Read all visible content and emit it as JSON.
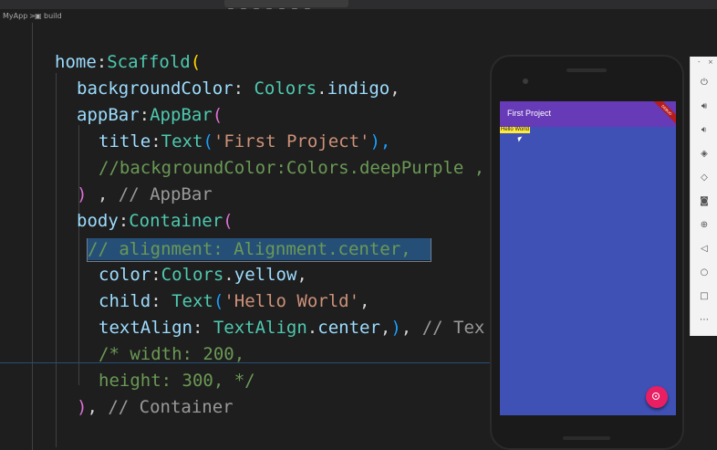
{
  "breadcrumb": {
    "items": [
      "MyApp",
      ">",
      "build"
    ]
  },
  "editor": {
    "lines": [
      [
        "home",
        ":",
        "Scaffold",
        "("
      ],
      [
        "backgroundColor",
        ": ",
        "Colors",
        ".",
        "indigo",
        ","
      ],
      [
        "appBar",
        ":",
        "AppBar",
        "("
      ],
      [
        "title",
        ":",
        "Text",
        "(",
        "'First Project'",
        "),"
      ],
      [
        "//backgroundColor:Colors.deepPurple ,"
      ],
      [
        ")",
        " , ",
        "// AppBar"
      ],
      [
        "body",
        ":",
        "Container",
        "("
      ],
      [
        "// alignment: Alignment.center,"
      ],
      [
        "color",
        ":",
        "Colors",
        ".",
        "yellow",
        ","
      ],
      [
        "child",
        ": ",
        "Text",
        "(",
        "'Hello World'",
        ","
      ],
      [
        "textAlign",
        ": ",
        "TextAlign",
        ".",
        "center",
        ",",
        ")",
        ", ",
        "// Tex"
      ],
      [
        "/* width: 200,"
      ],
      [
        "height: 300, */"
      ],
      [
        ")",
        ", ",
        "// Container"
      ]
    ]
  },
  "emulator": {
    "appbar_title": "First Project",
    "debug_banner": "DEBUG",
    "body_text": "Hello World",
    "colors": {
      "appbar": "#673ab7",
      "background": "#3f51b5",
      "text_bg": "#ffeb3b",
      "fab": "#e91e63"
    }
  },
  "sidepanel": {
    "top": [
      "-",
      "×"
    ],
    "icons": [
      "power-icon",
      "volume-up-icon",
      "volume-down-icon",
      "rotate-left-icon",
      "rotate-right-icon",
      "camera-icon",
      "zoom-icon",
      "back-icon",
      "home-icon",
      "overview-icon",
      "more-icon"
    ]
  }
}
